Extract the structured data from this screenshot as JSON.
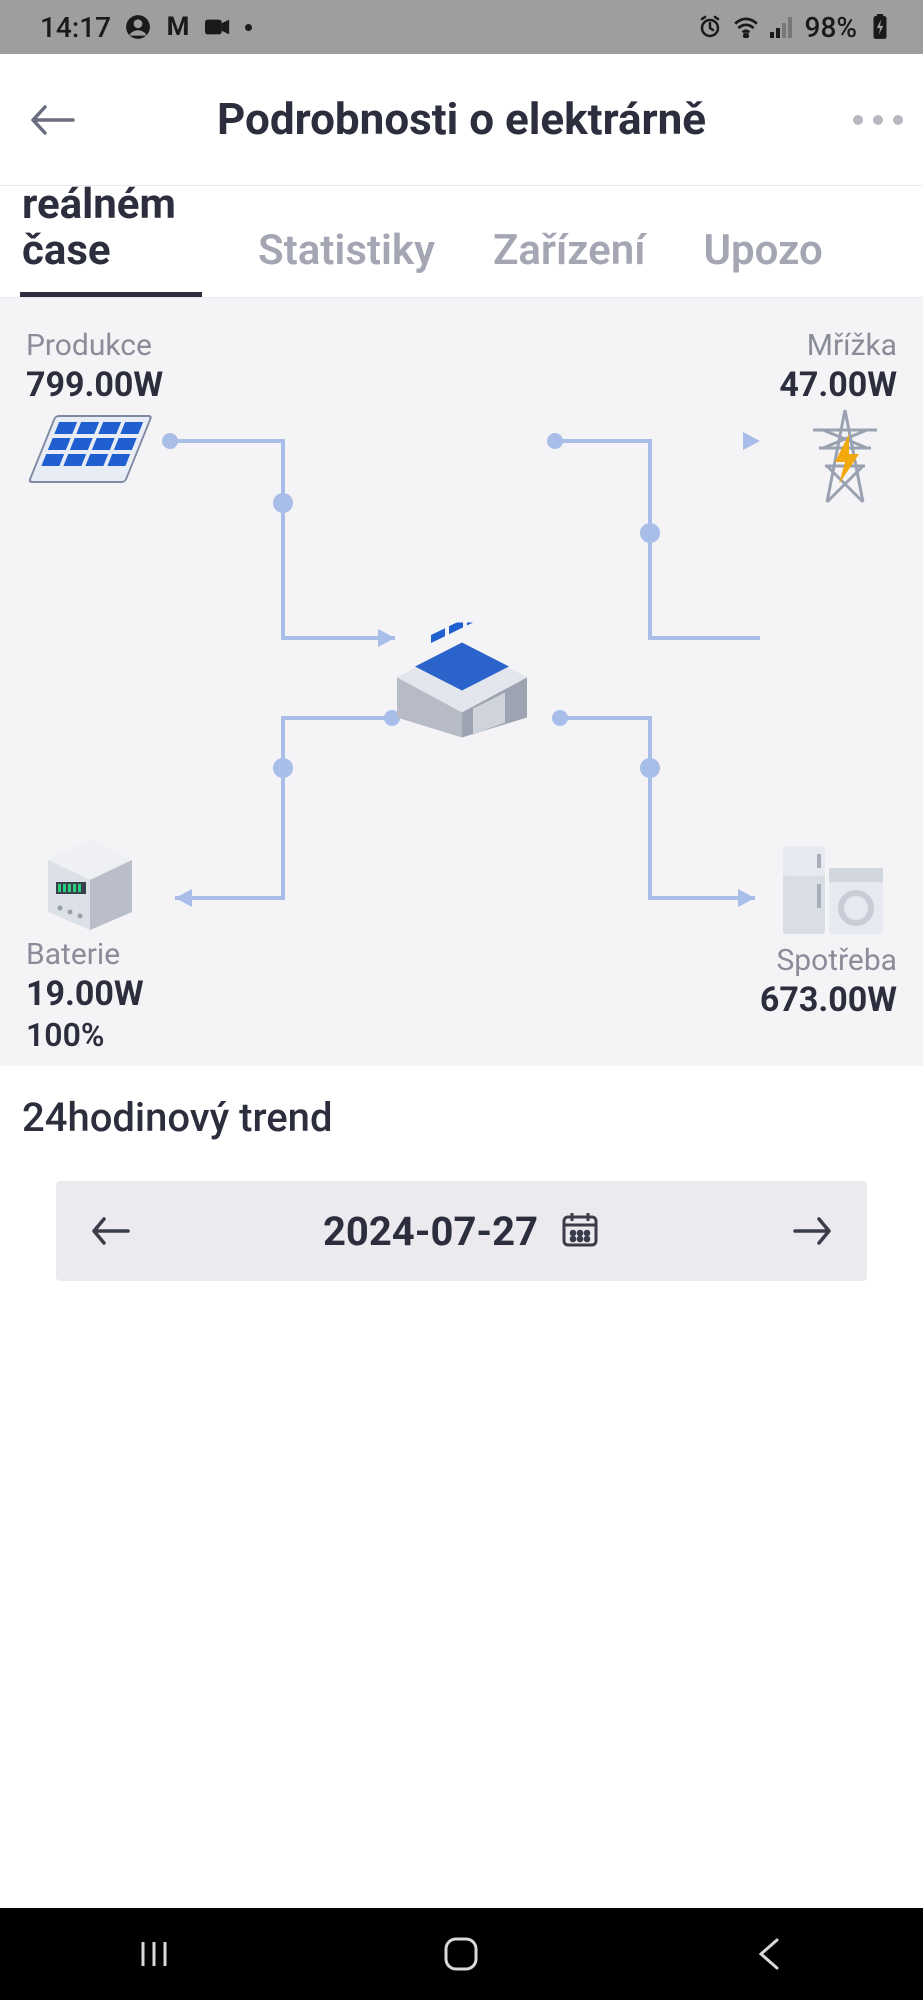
{
  "status_bar": {
    "time": "14:17",
    "battery_pct": "98%"
  },
  "header": {
    "title": "Podrobnosti o elektrárně"
  },
  "tabs": {
    "items": [
      {
        "label": "V reálném čase",
        "active": true
      },
      {
        "label": "Statistiky",
        "active": false
      },
      {
        "label": "Zařízení",
        "active": false
      },
      {
        "label": "Upozo",
        "active": false
      }
    ]
  },
  "diagram": {
    "production": {
      "label": "Produkce",
      "value": "799.00W"
    },
    "grid": {
      "label": "Mřížka",
      "value": "47.00W"
    },
    "battery": {
      "label": "Baterie",
      "value": "19.00W",
      "soc": "100%"
    },
    "consumption": {
      "label": "Spotřeba",
      "value": "673.00W"
    }
  },
  "trend": {
    "title": "24hodinový trend",
    "date": "2024-07-27"
  }
}
